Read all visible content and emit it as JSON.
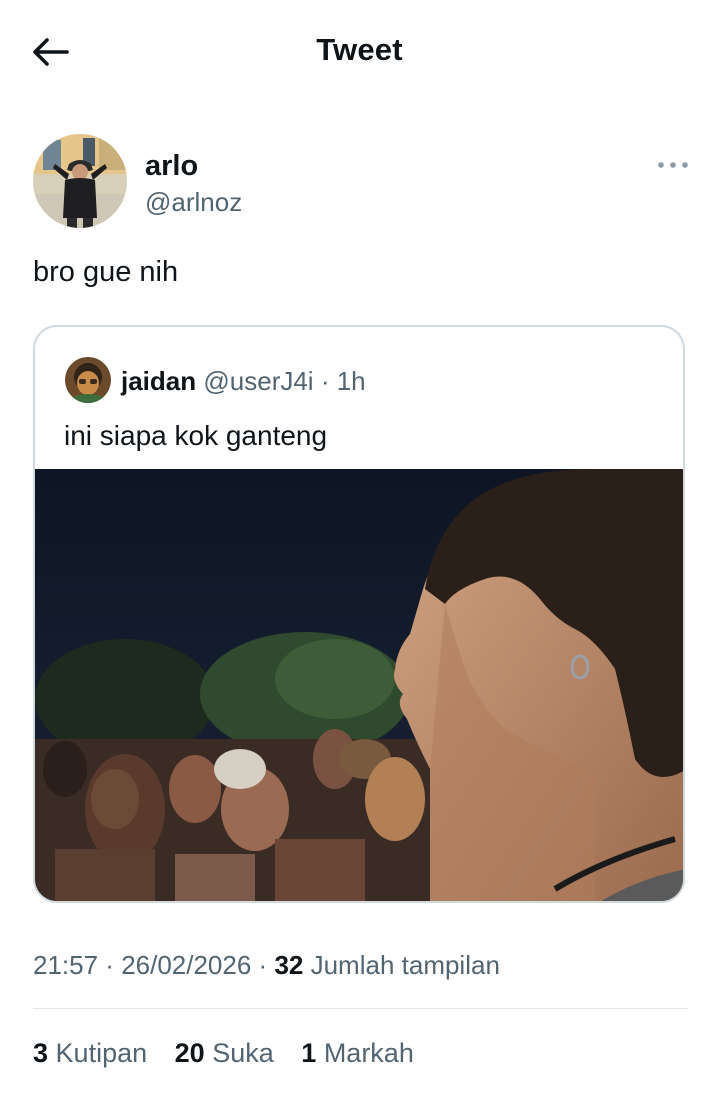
{
  "header": {
    "title": "Tweet",
    "back_icon": "arrow-left-icon"
  },
  "author": {
    "display_name": "arlo",
    "handle": "@arlnoz",
    "more_icon": "more-horizontal-icon"
  },
  "tweet": {
    "text": "bro gue nih"
  },
  "quoted_tweet": {
    "display_name": "jaidan",
    "handle": "@userJ4i",
    "separator": " · ",
    "time": "1h",
    "text": "ini siapa kok ganteng"
  },
  "meta": {
    "time": "21:57",
    "date": "26/02/2026",
    "separator": " · ",
    "views_count": "32",
    "views_label": "Jumlah tampilan"
  },
  "stats": {
    "quotes_count": "3",
    "quotes_label": "Kutipan",
    "likes_count": "20",
    "likes_label": "Suka",
    "bookmarks_count": "1",
    "bookmarks_label": "Markah"
  },
  "colors": {
    "text_primary": "#0f1419",
    "text_secondary": "#536471",
    "border": "#cfd9de"
  }
}
